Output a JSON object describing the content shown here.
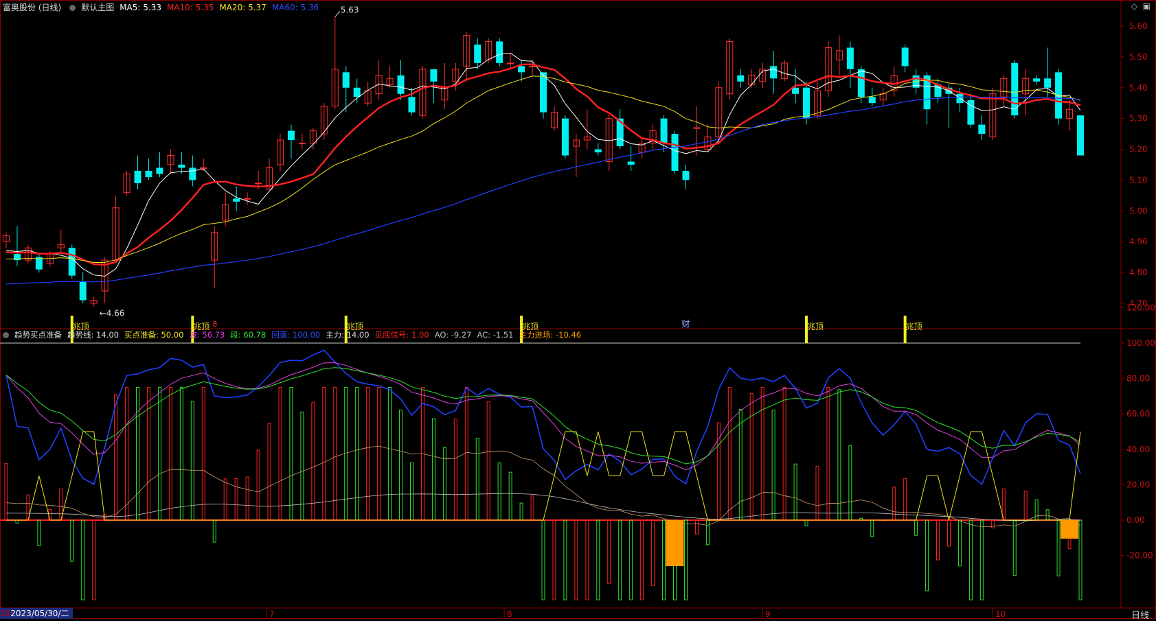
{
  "header": {
    "stock": "富奥股份 (日线)",
    "main_chart": "默认主图",
    "ma": [
      {
        "label": "MA5: 5.33",
        "color": "#ffffff"
      },
      {
        "label": "MA10: 5.35",
        "color": "#ff2020"
      },
      {
        "label": "MA20: 5.37",
        "color": "#f0e020"
      },
      {
        "label": "MA60: 5.36",
        "color": "#3050ff"
      }
    ]
  },
  "indicator_header": {
    "name": "趋势买点准备",
    "items": [
      {
        "label": "趋势线: 14.00",
        "color": "#dddddd"
      },
      {
        "label": "买点准备: 50.00",
        "color": "#f0e020"
      },
      {
        "label": "波: 56.73",
        "color": "#e040e0"
      },
      {
        "label": "段: 60.78",
        "color": "#30e030"
      },
      {
        "label": "回落: 100.00",
        "color": "#3050ff"
      },
      {
        "label": "主力: 14.00",
        "color": "#dddddd"
      },
      {
        "label": "见底信号: 1.00",
        "color": "#ff2020"
      },
      {
        "label": "AO: -9.27",
        "color": "#bbbbbb"
      },
      {
        "label": "AC: -1.51",
        "color": "#bbbbbb"
      },
      {
        "label": "主力进场: -10.46",
        "color": "#ff9900"
      }
    ]
  },
  "footer": {
    "date_prefix": "20",
    "date": "2023/05/30/二",
    "period": "日线",
    "months": [
      "7",
      "8",
      "9",
      "10"
    ]
  },
  "chart_data": [
    {
      "type": "candlestick",
      "y_axis_ticks": [
        "5.60",
        "5.50",
        "5.40",
        "5.30",
        "5.20",
        "5.10",
        "5.00",
        "4.90",
        "4.80",
        "4.70"
      ],
      "ylim": [
        4.66,
        5.66
      ],
      "annotations": [
        {
          "label": "5.63",
          "type": "high"
        },
        {
          "label": "4.66",
          "type": "low"
        },
        {
          "label": "8",
          "type": "event-mark"
        },
        {
          "label": "财",
          "type": "event-mark"
        }
      ],
      "candles": [
        [
          4.9,
          4.92,
          4.88,
          4.93
        ],
        [
          4.86,
          4.84,
          4.82,
          4.95
        ],
        [
          4.84,
          4.88,
          4.83,
          4.89
        ],
        [
          4.85,
          4.81,
          4.8,
          4.86
        ],
        [
          4.83,
          4.86,
          4.82,
          4.87
        ],
        [
          4.88,
          4.89,
          4.86,
          4.94
        ],
        [
          4.88,
          4.79,
          4.78,
          4.89
        ],
        [
          4.77,
          4.71,
          4.7,
          4.8
        ],
        [
          4.7,
          4.71,
          4.69,
          4.72
        ],
        [
          4.74,
          4.84,
          4.7,
          4.85
        ],
        [
          4.84,
          5.01,
          4.83,
          5.05
        ],
        [
          5.06,
          5.12,
          5.05,
          5.13
        ],
        [
          5.13,
          5.09,
          5.07,
          5.18
        ],
        [
          5.13,
          5.11,
          5.1,
          5.17
        ],
        [
          5.14,
          5.12,
          5.11,
          5.19
        ],
        [
          5.15,
          5.18,
          5.12,
          5.2
        ],
        [
          5.15,
          5.14,
          5.12,
          5.19
        ],
        [
          5.14,
          5.1,
          5.08,
          5.18
        ],
        [
          5.14,
          5.14,
          5.13,
          5.17
        ],
        [
          4.84,
          4.93,
          4.75,
          4.95
        ],
        [
          4.97,
          5.02,
          4.95,
          5.06
        ],
        [
          5.04,
          5.03,
          5.0,
          5.08
        ],
        [
          5.04,
          5.04,
          5.02,
          5.06
        ],
        [
          5.09,
          5.09,
          5.07,
          5.13
        ],
        [
          5.07,
          5.14,
          5.07,
          5.17
        ],
        [
          5.15,
          5.23,
          5.13,
          5.25
        ],
        [
          5.26,
          5.23,
          5.17,
          5.28
        ],
        [
          5.22,
          5.22,
          5.2,
          5.25
        ],
        [
          5.22,
          5.26,
          5.2,
          5.27
        ],
        [
          5.25,
          5.34,
          5.23,
          5.35
        ],
        [
          5.34,
          5.46,
          5.33,
          5.63
        ],
        [
          5.45,
          5.4,
          5.32,
          5.47
        ],
        [
          5.4,
          5.37,
          5.35,
          5.43
        ],
        [
          5.35,
          5.39,
          5.34,
          5.42
        ],
        [
          5.38,
          5.44,
          5.36,
          5.49
        ],
        [
          5.41,
          5.43,
          5.4,
          5.47
        ],
        [
          5.44,
          5.38,
          5.36,
          5.49
        ],
        [
          5.37,
          5.32,
          5.31,
          5.4
        ],
        [
          5.31,
          5.46,
          5.3,
          5.47
        ],
        [
          5.46,
          5.42,
          5.35,
          5.46
        ],
        [
          5.36,
          5.4,
          5.33,
          5.48
        ],
        [
          5.42,
          5.46,
          5.39,
          5.48
        ],
        [
          5.47,
          5.57,
          5.42,
          5.58
        ],
        [
          5.54,
          5.48,
          5.46,
          5.56
        ],
        [
          5.49,
          5.55,
          5.48,
          5.56
        ],
        [
          5.55,
          5.48,
          5.47,
          5.56
        ],
        [
          5.48,
          5.48,
          5.46,
          5.51
        ],
        [
          5.47,
          5.45,
          5.42,
          5.49
        ],
        [
          5.47,
          5.47,
          5.44,
          5.49
        ],
        [
          5.45,
          5.32,
          5.3,
          5.45
        ],
        [
          5.27,
          5.32,
          5.26,
          5.34
        ],
        [
          5.3,
          5.18,
          5.17,
          5.31
        ],
        [
          5.21,
          5.23,
          5.11,
          5.25
        ],
        [
          5.23,
          5.24,
          5.2,
          5.33
        ],
        [
          5.2,
          5.19,
          5.18,
          5.22
        ],
        [
          5.16,
          5.3,
          5.13,
          5.32
        ],
        [
          5.3,
          5.21,
          5.2,
          5.33
        ],
        [
          5.16,
          5.15,
          5.13,
          5.21
        ],
        [
          5.19,
          5.22,
          5.17,
          5.24
        ],
        [
          5.22,
          5.26,
          5.2,
          5.28
        ],
        [
          5.3,
          5.22,
          5.19,
          5.31
        ],
        [
          5.25,
          5.13,
          5.12,
          5.26
        ],
        [
          5.13,
          5.1,
          5.07,
          5.15
        ],
        [
          5.27,
          5.27,
          5.18,
          5.34
        ],
        [
          5.2,
          5.24,
          5.19,
          5.28
        ],
        [
          5.24,
          5.4,
          5.22,
          5.42
        ],
        [
          5.38,
          5.55,
          5.36,
          5.56
        ],
        [
          5.44,
          5.42,
          5.4,
          5.46
        ],
        [
          5.41,
          5.44,
          5.4,
          5.46
        ],
        [
          5.42,
          5.46,
          5.4,
          5.48
        ],
        [
          5.47,
          5.43,
          5.38,
          5.52
        ],
        [
          5.43,
          5.48,
          5.42,
          5.49
        ],
        [
          5.4,
          5.38,
          5.35,
          5.46
        ],
        [
          5.4,
          5.3,
          5.28,
          5.42
        ],
        [
          5.31,
          5.39,
          5.3,
          5.42
        ],
        [
          5.39,
          5.53,
          5.37,
          5.55
        ],
        [
          5.49,
          5.52,
          5.44,
          5.57
        ],
        [
          5.53,
          5.46,
          5.4,
          5.55
        ],
        [
          5.46,
          5.37,
          5.35,
          5.47
        ],
        [
          5.37,
          5.35,
          5.34,
          5.4
        ],
        [
          5.36,
          5.38,
          5.34,
          5.4
        ],
        [
          5.39,
          5.44,
          5.37,
          5.47
        ],
        [
          5.53,
          5.47,
          5.45,
          5.54
        ],
        [
          5.44,
          5.4,
          5.38,
          5.46
        ],
        [
          5.44,
          5.33,
          5.28,
          5.45
        ],
        [
          5.41,
          5.37,
          5.35,
          5.43
        ],
        [
          5.4,
          5.38,
          5.27,
          5.41
        ],
        [
          5.38,
          5.35,
          5.32,
          5.4
        ],
        [
          5.36,
          5.28,
          5.27,
          5.38
        ],
        [
          5.28,
          5.25,
          5.23,
          5.31
        ],
        [
          5.24,
          5.38,
          5.23,
          5.4
        ],
        [
          5.37,
          5.43,
          5.34,
          5.44
        ],
        [
          5.48,
          5.31,
          5.3,
          5.49
        ],
        [
          5.38,
          5.43,
          5.31,
          5.46
        ],
        [
          5.43,
          5.42,
          5.41,
          5.44
        ],
        [
          5.43,
          5.4,
          5.37,
          5.53
        ],
        [
          5.45,
          5.3,
          5.28,
          5.46
        ],
        [
          5.3,
          5.33,
          5.26,
          5.36
        ],
        [
          5.31,
          5.18,
          5.18,
          5.31
        ]
      ]
    },
    {
      "type": "indicator",
      "y_axis_ticks": [
        "120.00",
        "100.00",
        "80.00",
        "60.00",
        "40.00",
        "20.00",
        "0.00",
        "-20.00"
      ],
      "ylim": [
        -40,
        128
      ],
      "reference_line": 100,
      "top_label": "兆顶"
    }
  ]
}
